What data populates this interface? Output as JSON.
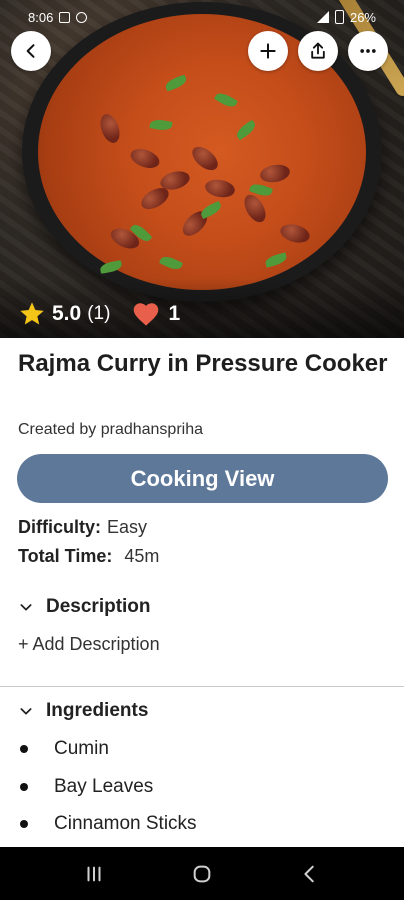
{
  "status_bar": {
    "time": "8:06",
    "battery": "26%"
  },
  "hero": {
    "rating": "5.0",
    "rating_count": "(1)",
    "likes": "1",
    "star_color": "#f5c518",
    "heart_color": "#e8604c"
  },
  "recipe": {
    "title": "Rajma Curry in Pressure Cooker",
    "creator": "Created by pradhanspriha",
    "cooking_view_label": "Cooking View",
    "difficulty_label": "Difficulty:",
    "difficulty_value": "Easy",
    "total_time_label": "Total Time:",
    "total_time_value": "45m"
  },
  "description": {
    "heading": "Description",
    "add_label": "+ Add Description"
  },
  "ingredients": {
    "heading": "Ingredients",
    "items": [
      "Cumin",
      "Bay Leaves",
      "Cinnamon Sticks"
    ]
  },
  "icons": {
    "back": "back-arrow-icon",
    "add": "plus-icon",
    "share": "share-icon",
    "more": "more-horizontal-icon",
    "chevron": "chevron-down-icon",
    "nav_recents": "recents-icon",
    "nav_home": "home-icon",
    "nav_back": "nav-back-icon"
  },
  "colors": {
    "accent_button": "#5d7899"
  }
}
